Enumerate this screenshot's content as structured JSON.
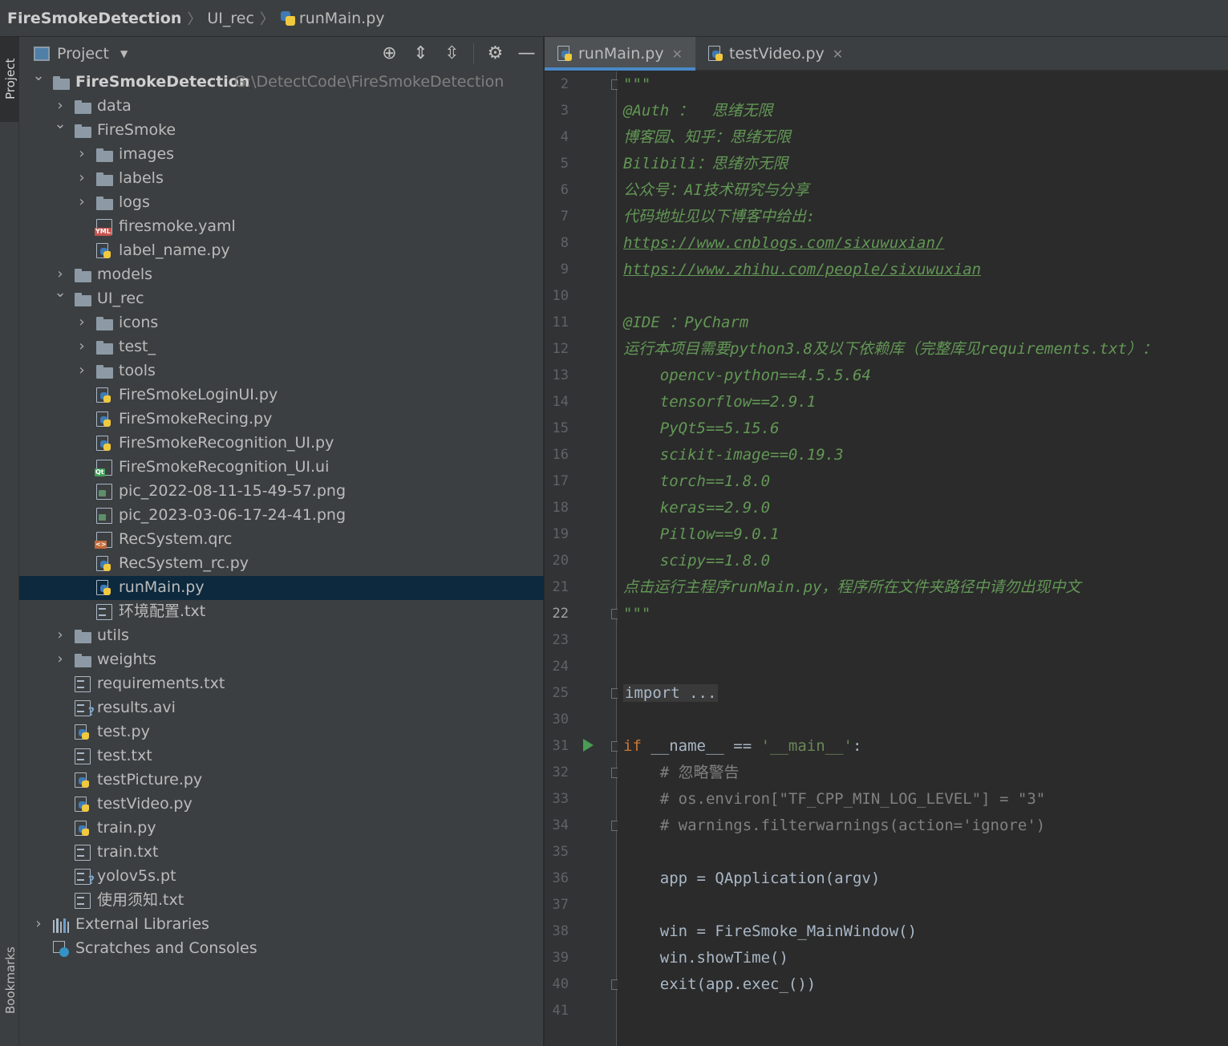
{
  "breadcrumb": {
    "project": "FireSmokeDetection",
    "folder": "UI_rec",
    "file": "runMain.py"
  },
  "toolstrip": {
    "project_label": "Project",
    "bookmarks_label": "Bookmarks"
  },
  "panel": {
    "title": "Project",
    "icons": [
      "crosshair-icon",
      "expand-all-icon",
      "collapse-all-icon",
      "gear-icon",
      "minimize-icon"
    ],
    "tree": [
      {
        "label": "FireSmokeDetection",
        "hint": "G:\\DetectCode\\FireSmokeDetection",
        "depth": 0,
        "kind": "folder",
        "chevron": "open",
        "bold": true
      },
      {
        "label": "data",
        "depth": 1,
        "kind": "folder",
        "chevron": "closed"
      },
      {
        "label": "FireSmoke",
        "depth": 1,
        "kind": "folder",
        "chevron": "open"
      },
      {
        "label": "images",
        "depth": 2,
        "kind": "folder",
        "chevron": "closed"
      },
      {
        "label": "labels",
        "depth": 2,
        "kind": "folder",
        "chevron": "closed"
      },
      {
        "label": "logs",
        "depth": 2,
        "kind": "folder",
        "chevron": "closed"
      },
      {
        "label": "firesmoke.yaml",
        "depth": 2,
        "kind": "yaml"
      },
      {
        "label": "label_name.py",
        "depth": 2,
        "kind": "py"
      },
      {
        "label": "models",
        "depth": 1,
        "kind": "folder",
        "chevron": "closed"
      },
      {
        "label": "UI_rec",
        "depth": 1,
        "kind": "folder",
        "chevron": "open"
      },
      {
        "label": "icons",
        "depth": 2,
        "kind": "folder",
        "chevron": "closed"
      },
      {
        "label": "test_",
        "depth": 2,
        "kind": "folder",
        "chevron": "closed"
      },
      {
        "label": "tools",
        "depth": 2,
        "kind": "folder",
        "chevron": "closed"
      },
      {
        "label": "FireSmokeLoginUI.py",
        "depth": 2,
        "kind": "py"
      },
      {
        "label": "FireSmokeRecing.py",
        "depth": 2,
        "kind": "py"
      },
      {
        "label": "FireSmokeRecognition_UI.py",
        "depth": 2,
        "kind": "py"
      },
      {
        "label": "FireSmokeRecognition_UI.ui",
        "depth": 2,
        "kind": "ui"
      },
      {
        "label": "pic_2022-08-11-15-49-57.png",
        "depth": 2,
        "kind": "img"
      },
      {
        "label": "pic_2023-03-06-17-24-41.png",
        "depth": 2,
        "kind": "img"
      },
      {
        "label": "RecSystem.qrc",
        "depth": 2,
        "kind": "qrc"
      },
      {
        "label": "RecSystem_rc.py",
        "depth": 2,
        "kind": "py"
      },
      {
        "label": "runMain.py",
        "depth": 2,
        "kind": "py",
        "selected": true
      },
      {
        "label": "环境配置.txt",
        "depth": 2,
        "kind": "txt"
      },
      {
        "label": "utils",
        "depth": 1,
        "kind": "folder",
        "chevron": "closed"
      },
      {
        "label": "weights",
        "depth": 1,
        "kind": "folder",
        "chevron": "closed"
      },
      {
        "label": "requirements.txt",
        "depth": 1,
        "kind": "txt"
      },
      {
        "label": "results.avi",
        "depth": 1,
        "kind": "unknown"
      },
      {
        "label": "test.py",
        "depth": 1,
        "kind": "py"
      },
      {
        "label": "test.txt",
        "depth": 1,
        "kind": "txt"
      },
      {
        "label": "testPicture.py",
        "depth": 1,
        "kind": "py"
      },
      {
        "label": "testVideo.py",
        "depth": 1,
        "kind": "py"
      },
      {
        "label": "train.py",
        "depth": 1,
        "kind": "py"
      },
      {
        "label": "train.txt",
        "depth": 1,
        "kind": "txt"
      },
      {
        "label": "yolov5s.pt",
        "depth": 1,
        "kind": "unknown"
      },
      {
        "label": "使用须知.txt",
        "depth": 1,
        "kind": "txt"
      },
      {
        "label": "External Libraries",
        "depth": 0,
        "kind": "lib",
        "chevron": "closed"
      },
      {
        "label": "Scratches and Consoles",
        "depth": 0,
        "kind": "scratch"
      }
    ]
  },
  "editor": {
    "tabs": [
      {
        "label": "runMain.py",
        "active": true
      },
      {
        "label": "testVideo.py",
        "active": false
      }
    ],
    "current_line": "22",
    "lines": [
      {
        "num": "2",
        "fold": true,
        "tokens": [
          [
            "doc",
            "\"\"\""
          ]
        ]
      },
      {
        "num": "3",
        "tokens": [
          [
            "doc",
            "@Auth ：  思绪无限"
          ]
        ]
      },
      {
        "num": "4",
        "tokens": [
          [
            "doc",
            "博客园、知乎：思绪无限"
          ]
        ]
      },
      {
        "num": "5",
        "tokens": [
          [
            "doc",
            "Bilibili：思绪亦无限"
          ]
        ]
      },
      {
        "num": "6",
        "tokens": [
          [
            "doc",
            "公众号：AI技术研究与分享"
          ]
        ]
      },
      {
        "num": "7",
        "tokens": [
          [
            "doc",
            "代码地址见以下博客中给出:"
          ]
        ]
      },
      {
        "num": "8",
        "tokens": [
          [
            "link",
            "https://www.cnblogs.com/sixuwuxian/"
          ]
        ]
      },
      {
        "num": "9",
        "tokens": [
          [
            "link",
            "https://www.zhihu.com/people/sixuwuxian"
          ]
        ]
      },
      {
        "num": "10",
        "tokens": []
      },
      {
        "num": "11",
        "tokens": [
          [
            "doc",
            "@IDE ：PyCharm"
          ]
        ]
      },
      {
        "num": "12",
        "tokens": [
          [
            "doc",
            "运行本项目需要python3.8及以下依赖库（完整库见requirements.txt）："
          ]
        ]
      },
      {
        "num": "13",
        "tokens": [
          [
            "doc",
            "    opencv-python==4.5.5.64"
          ]
        ]
      },
      {
        "num": "14",
        "tokens": [
          [
            "doc",
            "    tensorflow==2.9.1"
          ]
        ]
      },
      {
        "num": "15",
        "tokens": [
          [
            "doc",
            "    PyQt5==5.15.6"
          ]
        ]
      },
      {
        "num": "16",
        "tokens": [
          [
            "doc",
            "    scikit-image==0.19.3"
          ]
        ]
      },
      {
        "num": "17",
        "tokens": [
          [
            "doc",
            "    torch==1.8.0"
          ]
        ]
      },
      {
        "num": "18",
        "tokens": [
          [
            "doc",
            "    keras==2.9.0"
          ]
        ]
      },
      {
        "num": "19",
        "tokens": [
          [
            "doc",
            "    Pillow==9.0.1"
          ]
        ]
      },
      {
        "num": "20",
        "tokens": [
          [
            "doc",
            "    scipy==1.8.0"
          ]
        ]
      },
      {
        "num": "21",
        "tokens": [
          [
            "doc",
            "点击运行主程序runMain.py，程序所在文件夹路径中请勿出现中文"
          ]
        ]
      },
      {
        "num": "22",
        "fold": true,
        "tokens": [
          [
            "doc",
            "\"\"\""
          ]
        ]
      },
      {
        "num": "23",
        "tokens": []
      },
      {
        "num": "24",
        "tokens": []
      },
      {
        "num": "25",
        "fold": true,
        "tokens": [
          [
            "folded",
            "import ..."
          ]
        ]
      },
      {
        "num": "30",
        "tokens": []
      },
      {
        "num": "31",
        "run": true,
        "fold": true,
        "tokens": [
          [
            "kw",
            "if "
          ],
          [
            "plain",
            "__name__ == "
          ],
          [
            "str",
            "'__main__'"
          ],
          [
            "plain",
            ":"
          ]
        ]
      },
      {
        "num": "32",
        "fold": true,
        "tokens": [
          [
            "cmt",
            "    # 忽略警告"
          ]
        ]
      },
      {
        "num": "33",
        "tokens": [
          [
            "cmt",
            "    # os.environ[\"TF_CPP_MIN_LOG_LEVEL\"] = \"3\""
          ]
        ]
      },
      {
        "num": "34",
        "fold": true,
        "tokens": [
          [
            "cmt",
            "    # warnings.filterwarnings(action='ignore')"
          ]
        ]
      },
      {
        "num": "35",
        "tokens": []
      },
      {
        "num": "36",
        "tokens": [
          [
            "plain",
            "    app = QApplication(argv)"
          ]
        ]
      },
      {
        "num": "37",
        "tokens": []
      },
      {
        "num": "38",
        "tokens": [
          [
            "plain",
            "    win = FireSmoke_MainWindow()"
          ]
        ]
      },
      {
        "num": "39",
        "tokens": [
          [
            "plain",
            "    win.showTime()"
          ]
        ]
      },
      {
        "num": "40",
        "fold": true,
        "tokens": [
          [
            "plain",
            "    exit(app.exec_())"
          ]
        ]
      },
      {
        "num": "41",
        "tokens": []
      }
    ]
  }
}
